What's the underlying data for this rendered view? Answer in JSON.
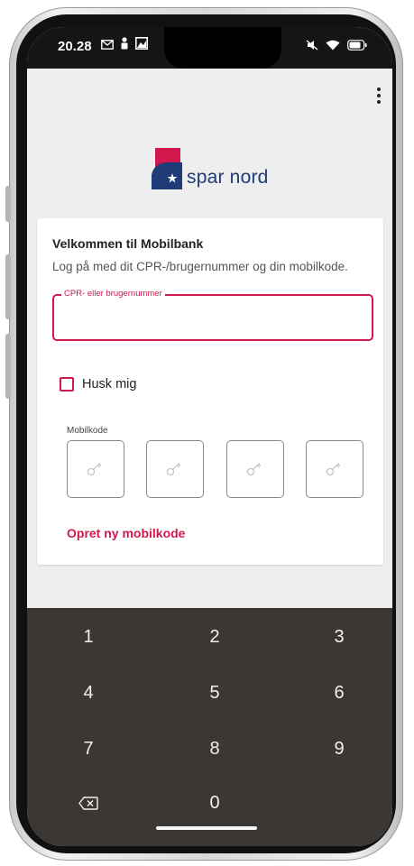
{
  "status_bar": {
    "time": "20.28",
    "left_icons": [
      "gmail-icon",
      "person-icon",
      "gallery-icon"
    ],
    "right_icons": [
      "mute-icon",
      "wifi-icon",
      "battery-icon"
    ]
  },
  "app": {
    "logo_text": "spar nord",
    "brand_colors": {
      "accent": "#d1184c",
      "navy": "#1f3c78"
    },
    "welcome_title": "Velkommen til Mobilbank",
    "subtitle": "Log på med dit CPR-/brugernummer og din mobilkode.",
    "cpr_field": {
      "label": "CPR- eller brugernummer",
      "value": ""
    },
    "remember_me": {
      "label": "Husk mig",
      "checked": false
    },
    "mobilkode": {
      "label": "Mobilkode",
      "digits": 4,
      "icon": "key-icon"
    },
    "create_code_link": "Opret ny mobilkode"
  },
  "keyboard": {
    "keys": [
      "1",
      "2",
      "3",
      "4",
      "5",
      "6",
      "7",
      "8",
      "9",
      "backspace-icon",
      "0",
      ""
    ]
  }
}
